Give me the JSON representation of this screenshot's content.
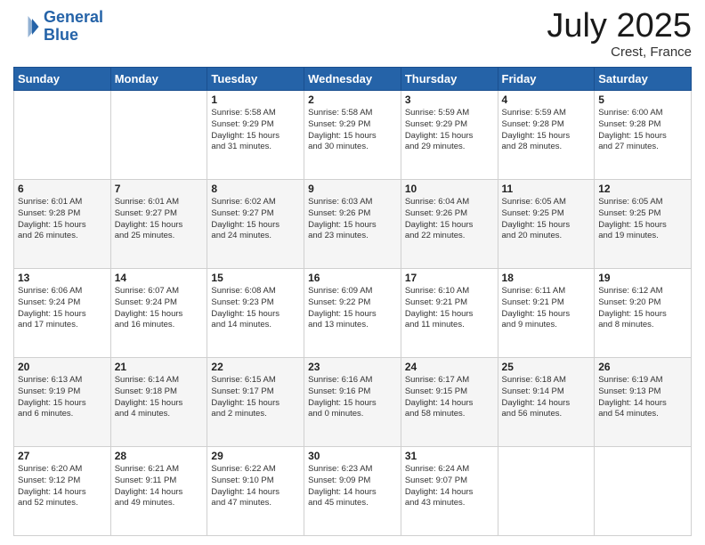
{
  "header": {
    "logo_line1": "General",
    "logo_line2": "Blue",
    "month_title": "July 2025",
    "location": "Crest, France"
  },
  "days_of_week": [
    "Sunday",
    "Monday",
    "Tuesday",
    "Wednesday",
    "Thursday",
    "Friday",
    "Saturday"
  ],
  "weeks": [
    [
      {
        "day": "",
        "info": ""
      },
      {
        "day": "",
        "info": ""
      },
      {
        "day": "1",
        "info": "Sunrise: 5:58 AM\nSunset: 9:29 PM\nDaylight: 15 hours\nand 31 minutes."
      },
      {
        "day": "2",
        "info": "Sunrise: 5:58 AM\nSunset: 9:29 PM\nDaylight: 15 hours\nand 30 minutes."
      },
      {
        "day": "3",
        "info": "Sunrise: 5:59 AM\nSunset: 9:29 PM\nDaylight: 15 hours\nand 29 minutes."
      },
      {
        "day": "4",
        "info": "Sunrise: 5:59 AM\nSunset: 9:28 PM\nDaylight: 15 hours\nand 28 minutes."
      },
      {
        "day": "5",
        "info": "Sunrise: 6:00 AM\nSunset: 9:28 PM\nDaylight: 15 hours\nand 27 minutes."
      }
    ],
    [
      {
        "day": "6",
        "info": "Sunrise: 6:01 AM\nSunset: 9:28 PM\nDaylight: 15 hours\nand 26 minutes."
      },
      {
        "day": "7",
        "info": "Sunrise: 6:01 AM\nSunset: 9:27 PM\nDaylight: 15 hours\nand 25 minutes."
      },
      {
        "day": "8",
        "info": "Sunrise: 6:02 AM\nSunset: 9:27 PM\nDaylight: 15 hours\nand 24 minutes."
      },
      {
        "day": "9",
        "info": "Sunrise: 6:03 AM\nSunset: 9:26 PM\nDaylight: 15 hours\nand 23 minutes."
      },
      {
        "day": "10",
        "info": "Sunrise: 6:04 AM\nSunset: 9:26 PM\nDaylight: 15 hours\nand 22 minutes."
      },
      {
        "day": "11",
        "info": "Sunrise: 6:05 AM\nSunset: 9:25 PM\nDaylight: 15 hours\nand 20 minutes."
      },
      {
        "day": "12",
        "info": "Sunrise: 6:05 AM\nSunset: 9:25 PM\nDaylight: 15 hours\nand 19 minutes."
      }
    ],
    [
      {
        "day": "13",
        "info": "Sunrise: 6:06 AM\nSunset: 9:24 PM\nDaylight: 15 hours\nand 17 minutes."
      },
      {
        "day": "14",
        "info": "Sunrise: 6:07 AM\nSunset: 9:24 PM\nDaylight: 15 hours\nand 16 minutes."
      },
      {
        "day": "15",
        "info": "Sunrise: 6:08 AM\nSunset: 9:23 PM\nDaylight: 15 hours\nand 14 minutes."
      },
      {
        "day": "16",
        "info": "Sunrise: 6:09 AM\nSunset: 9:22 PM\nDaylight: 15 hours\nand 13 minutes."
      },
      {
        "day": "17",
        "info": "Sunrise: 6:10 AM\nSunset: 9:21 PM\nDaylight: 15 hours\nand 11 minutes."
      },
      {
        "day": "18",
        "info": "Sunrise: 6:11 AM\nSunset: 9:21 PM\nDaylight: 15 hours\nand 9 minutes."
      },
      {
        "day": "19",
        "info": "Sunrise: 6:12 AM\nSunset: 9:20 PM\nDaylight: 15 hours\nand 8 minutes."
      }
    ],
    [
      {
        "day": "20",
        "info": "Sunrise: 6:13 AM\nSunset: 9:19 PM\nDaylight: 15 hours\nand 6 minutes."
      },
      {
        "day": "21",
        "info": "Sunrise: 6:14 AM\nSunset: 9:18 PM\nDaylight: 15 hours\nand 4 minutes."
      },
      {
        "day": "22",
        "info": "Sunrise: 6:15 AM\nSunset: 9:17 PM\nDaylight: 15 hours\nand 2 minutes."
      },
      {
        "day": "23",
        "info": "Sunrise: 6:16 AM\nSunset: 9:16 PM\nDaylight: 15 hours\nand 0 minutes."
      },
      {
        "day": "24",
        "info": "Sunrise: 6:17 AM\nSunset: 9:15 PM\nDaylight: 14 hours\nand 58 minutes."
      },
      {
        "day": "25",
        "info": "Sunrise: 6:18 AM\nSunset: 9:14 PM\nDaylight: 14 hours\nand 56 minutes."
      },
      {
        "day": "26",
        "info": "Sunrise: 6:19 AM\nSunset: 9:13 PM\nDaylight: 14 hours\nand 54 minutes."
      }
    ],
    [
      {
        "day": "27",
        "info": "Sunrise: 6:20 AM\nSunset: 9:12 PM\nDaylight: 14 hours\nand 52 minutes."
      },
      {
        "day": "28",
        "info": "Sunrise: 6:21 AM\nSunset: 9:11 PM\nDaylight: 14 hours\nand 49 minutes."
      },
      {
        "day": "29",
        "info": "Sunrise: 6:22 AM\nSunset: 9:10 PM\nDaylight: 14 hours\nand 47 minutes."
      },
      {
        "day": "30",
        "info": "Sunrise: 6:23 AM\nSunset: 9:09 PM\nDaylight: 14 hours\nand 45 minutes."
      },
      {
        "day": "31",
        "info": "Sunrise: 6:24 AM\nSunset: 9:07 PM\nDaylight: 14 hours\nand 43 minutes."
      },
      {
        "day": "",
        "info": ""
      },
      {
        "day": "",
        "info": ""
      }
    ]
  ]
}
